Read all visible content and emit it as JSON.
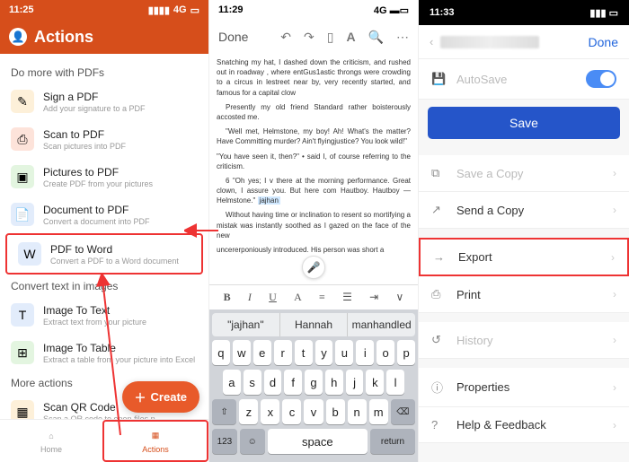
{
  "col1": {
    "status": {
      "time": "11:25",
      "net": "4G",
      "sig": "▮▮▮▮"
    },
    "title": "Actions",
    "section1": "Do more with PDFs",
    "items1": [
      {
        "title": "Sign a PDF",
        "sub": "Add your signature to a PDF",
        "bg": "#fdf0d9",
        "glyph": "✎"
      },
      {
        "title": "Scan to PDF",
        "sub": "Scan pictures into PDF",
        "bg": "#fde3da",
        "glyph": "⎙"
      },
      {
        "title": "Pictures to PDF",
        "sub": "Create PDF from your pictures",
        "bg": "#e3f5e0",
        "glyph": "▣"
      },
      {
        "title": "Document to PDF",
        "sub": "Convert a document into PDF",
        "bg": "#e2ecfb",
        "glyph": "📄"
      },
      {
        "title": "PDF to Word",
        "sub": "Convert a PDF to a Word document",
        "bg": "#e2ecfb",
        "glyph": "W",
        "hl": true
      }
    ],
    "section2": "Convert text in images",
    "items2": [
      {
        "title": "Image To Text",
        "sub": "Extract text from your picture",
        "bg": "#e2ecfb",
        "glyph": "T"
      },
      {
        "title": "Image To Table",
        "sub": "Extract a table from your picture into Excel",
        "bg": "#e3f5e0",
        "glyph": "⊞"
      }
    ],
    "section3": "More actions",
    "items3": [
      {
        "title": "Scan QR Code",
        "sub": "Scan a QR code to open files p",
        "bg": "#fdf0d9",
        "glyph": "▦"
      }
    ],
    "fab": "Create",
    "nav": {
      "home": "Home",
      "actions": "Actions"
    }
  },
  "col2": {
    "status": {
      "time": "11:29",
      "net": "4G"
    },
    "done": "Done",
    "doc": {
      "p1": "Snatching my hat, I dashed down the criticism, and rushed out in roadway , where entGus1astic throngs were crowding to a circus in lestreet near by, very recently started, and famous for a capital clow",
      "p2": "Presently my old friend Standard rather boisterously accosted me.",
      "p3": "\"Well met, Helmstone, my boy! Ah! What's the matter? Have Committing murder? Ain't flyingjustice? You look            wild!\"",
      "p4": "\"You have seen it, then?\" • said I, of course referring to the criticism.",
      "p5": "6  \"Oh yes; I v there at the morning performance. Great clown, I assure you. But here com Hautboy. Hautboy — Helmstone.\"",
      "hl": "jajhan",
      "p6": "Without having time or inclination to resent so mortifying a mistak was instantly soothed as I gazed on the face of the new",
      "p7": "uncererponiously introduced. His person was short a"
    },
    "sug": [
      "\"jajhan\"",
      "Hannah",
      "manhandled"
    ],
    "rows": {
      "r1": [
        "q",
        "w",
        "e",
        "r",
        "t",
        "y",
        "u",
        "i",
        "o",
        "p"
      ],
      "r2": [
        "a",
        "s",
        "d",
        "f",
        "g",
        "h",
        "j",
        "k",
        "l"
      ],
      "r3": [
        "z",
        "x",
        "c",
        "v",
        "b",
        "n",
        "m"
      ]
    },
    "fn": {
      "shift": "⇧",
      "del": "⌫",
      "num": "123",
      "emoji": "☺",
      "space": "space",
      "ret": "return"
    }
  },
  "col3": {
    "status": {
      "time": "11:33"
    },
    "done": "Done",
    "autosave": "AutoSave",
    "save": "Save",
    "rows": [
      {
        "label": "Save a Copy",
        "icon": "⧉",
        "dis": true
      },
      {
        "label": "Send a Copy",
        "icon": "↗"
      },
      {
        "label": "Export",
        "icon": "→",
        "hl": true
      },
      {
        "label": "Print",
        "icon": "⎙"
      },
      {
        "label": "History",
        "icon": "↺",
        "dis": true
      },
      {
        "label": "Properties",
        "icon": "ⓘ"
      },
      {
        "label": "Help & Feedback",
        "icon": "?"
      }
    ]
  }
}
